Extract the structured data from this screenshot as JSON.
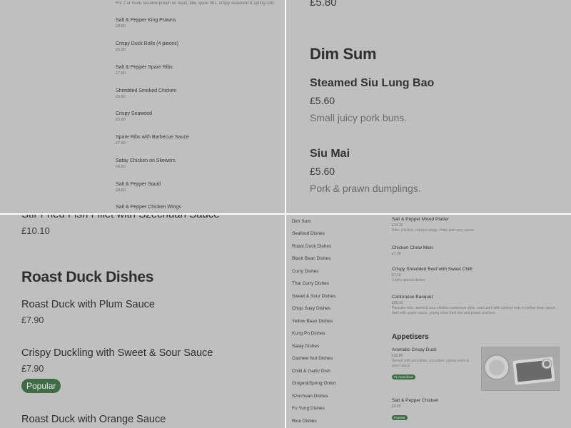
{
  "top_left": {
    "intro": "For 2 or more sesame prawn on toast, bbq spare ribs, crispy seaweed & spring rolls",
    "items": [
      {
        "name": "Salt & Pepper King Prawns",
        "price": "£8.80"
      },
      {
        "name": "Crispy Duck Rolls (4 pieces)",
        "price": "£5.30"
      },
      {
        "name": "Salt & Pepper Spare Ribs",
        "price": "£7.60"
      },
      {
        "name": "Shredded Smoked Chicken",
        "price": "£6.60"
      },
      {
        "name": "Crispy Seaweed",
        "price": "£5.80"
      },
      {
        "name": "Spare Ribs with Barbecue Sauce",
        "price": "£7.60"
      },
      {
        "name": "Satay Chicken on Skewers",
        "price": "£6.60"
      },
      {
        "name": "Salt & Pepper Squid",
        "price": "£8.60"
      },
      {
        "name": "Salt & Pepper Chicken Wings",
        "price": ""
      }
    ]
  },
  "top_right": {
    "prev_price": "£5.80",
    "section_title": "Dim Sum",
    "items": [
      {
        "name": "Steamed Siu Lung Bao",
        "price": "£5.60",
        "description": "Small juicy pork buns."
      },
      {
        "name": "Siu Mai",
        "price": "£5.60",
        "description": "Pork & prawn dumplings."
      }
    ]
  },
  "bottom_left": {
    "prev_name": "Stir Fried Fish Fillet with Szechuan Sauce",
    "prev_price": "£10.10",
    "section_title": "Roast Duck Dishes",
    "items": [
      {
        "name": "Roast Duck with Plum Sauce",
        "price": "£7.90",
        "badge": ""
      },
      {
        "name": "Crispy Duckling with Sweet & Sour Sauce",
        "price": "£7.90",
        "badge": "Popular"
      },
      {
        "name": "Roast Duck with Orange Sauce",
        "price": "",
        "badge": ""
      }
    ]
  },
  "bottom_right": {
    "categories": [
      "Dim Sum",
      "Seafood Dishes",
      "Roast Duck Dishes",
      "Black Bean Dishes",
      "Curry Dishes",
      "Thai Curry Dishes",
      "Sweet & Sour Dishes",
      "Chop Suey Dishes",
      "Yellow Bean Dishes",
      "Kung Po Dishes",
      "Satay Dishes",
      "Cashew Nut Dishes",
      "Chilli & Garlic Dish",
      "Ginger&Spring Onion",
      "Szechuan Dishes",
      "Fu Yung Dishes",
      "Rice Dishes"
    ],
    "items": [
      {
        "name": "Salt & Pepper Mixed Platter",
        "price": "£14.10",
        "description": "Ribs, chicken, chicken wings, chips and curry sauce"
      },
      {
        "name": "Chicken Chow Mein",
        "price": "£7.30",
        "description": ""
      },
      {
        "name": "Crispy Shredded Beef with Sweet Chilli",
        "price": "£7.10",
        "description": "Chef's special dishes"
      },
      {
        "name": "Cantonese Banquet",
        "price": "£26.10",
        "description": "Pancake rolls, sweet & sour chicken cantonese style, roast pork with cashew nuts in yellow bean sauce, beef with oyster sauce, young chow fried rice and prawn crackers"
      }
    ],
    "appetisers_title": "Appetisers",
    "appetisers": [
      {
        "name": "Aromatic Crispy Duck",
        "price": "£10.80",
        "description": "Served with pancakes, cucumber, spring onion & plum sauce",
        "badge": "#1 most liked"
      },
      {
        "name": "Salt & Pepper Chicken",
        "price": "£9.60",
        "description": "",
        "badge": "Popular"
      }
    ],
    "colors": {
      "badge": "#3f6b46",
      "overlay": "#bfbfbf"
    }
  }
}
